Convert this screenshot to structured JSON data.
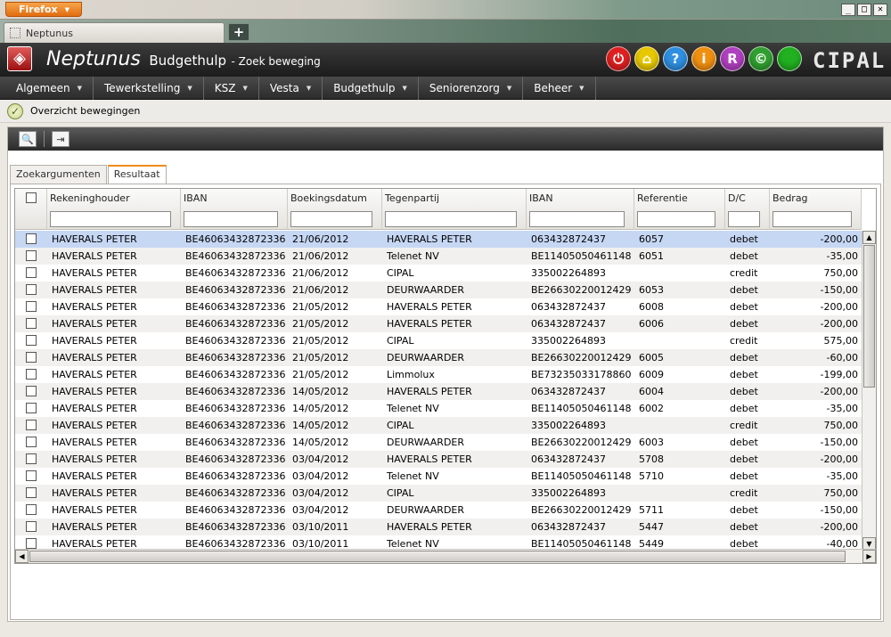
{
  "browser": {
    "menu_label": "Firefox",
    "tab_title": "Neptunus",
    "new_tab": "+",
    "win_min": "_",
    "win_max": "□",
    "win_close": "✕"
  },
  "app": {
    "name": "Neptunus",
    "module": "Budgethulp",
    "subtitle": "- Zoek beweging",
    "vendor_logo": "CIPAL",
    "header_icons": [
      {
        "name": "power-icon",
        "glyph": "⏻",
        "color": "#e02020"
      },
      {
        "name": "home-icon",
        "glyph": "⌂",
        "color": "#e8c800"
      },
      {
        "name": "help-icon",
        "glyph": "?",
        "color": "#2f8fe0"
      },
      {
        "name": "info-icon",
        "glyph": "i",
        "color": "#f09010"
      },
      {
        "name": "r-icon",
        "glyph": "R",
        "color": "#b040c0"
      },
      {
        "name": "copyright-icon",
        "glyph": "©",
        "color": "#30a030"
      },
      {
        "name": "status-icon",
        "glyph": "",
        "color": "#20b020"
      }
    ]
  },
  "menu": [
    "Algemeen",
    "Tewerkstelling",
    "KSZ",
    "Vesta",
    "Budgethulp",
    "Seniorenzorg",
    "Beheer"
  ],
  "status": {
    "text": "Overzicht bewegingen"
  },
  "toolbar": {
    "search_icon": "🔍",
    "exit_icon": "⇥"
  },
  "tabs": [
    {
      "label": "Zoekargumenten",
      "active": false
    },
    {
      "label": "Resultaat",
      "active": true
    }
  ],
  "grid": {
    "columns": [
      "Rekeninghouder",
      "IBAN",
      "Boekingsdatum",
      "Tegenpartij",
      "IBAN",
      "Referentie",
      "D/C",
      "Bedrag"
    ],
    "rows": [
      [
        "HAVERALS PETER",
        "BE46063432872336",
        "21/06/2012",
        "HAVERALS PETER",
        "063432872437",
        "6057",
        "debet",
        "-200,00"
      ],
      [
        "HAVERALS PETER",
        "BE46063432872336",
        "21/06/2012",
        "Telenet NV",
        "BE11405050461148",
        "6051",
        "debet",
        "-35,00"
      ],
      [
        "HAVERALS PETER",
        "BE46063432872336",
        "21/06/2012",
        "CIPAL",
        "335002264893",
        "",
        "credit",
        "750,00"
      ],
      [
        "HAVERALS PETER",
        "BE46063432872336",
        "21/06/2012",
        "DEURWAARDER",
        "BE26630220012429",
        "6053",
        "debet",
        "-150,00"
      ],
      [
        "HAVERALS PETER",
        "BE46063432872336",
        "21/05/2012",
        "HAVERALS PETER",
        "063432872437",
        "6008",
        "debet",
        "-200,00"
      ],
      [
        "HAVERALS PETER",
        "BE46063432872336",
        "21/05/2012",
        "HAVERALS PETER",
        "063432872437",
        "6006",
        "debet",
        "-200,00"
      ],
      [
        "HAVERALS PETER",
        "BE46063432872336",
        "21/05/2012",
        "CIPAL",
        "335002264893",
        "",
        "credit",
        "575,00"
      ],
      [
        "HAVERALS PETER",
        "BE46063432872336",
        "21/05/2012",
        "DEURWAARDER",
        "BE26630220012429",
        "6005",
        "debet",
        "-60,00"
      ],
      [
        "HAVERALS PETER",
        "BE46063432872336",
        "21/05/2012",
        "Limmolux",
        "BE73235033178860",
        "6009",
        "debet",
        "-199,00"
      ],
      [
        "HAVERALS PETER",
        "BE46063432872336",
        "14/05/2012",
        "HAVERALS PETER",
        "063432872437",
        "6004",
        "debet",
        "-200,00"
      ],
      [
        "HAVERALS PETER",
        "BE46063432872336",
        "14/05/2012",
        "Telenet NV",
        "BE11405050461148",
        "6002",
        "debet",
        "-35,00"
      ],
      [
        "HAVERALS PETER",
        "BE46063432872336",
        "14/05/2012",
        "CIPAL",
        "335002264893",
        "",
        "credit",
        "750,00"
      ],
      [
        "HAVERALS PETER",
        "BE46063432872336",
        "14/05/2012",
        "DEURWAARDER",
        "BE26630220012429",
        "6003",
        "debet",
        "-150,00"
      ],
      [
        "HAVERALS PETER",
        "BE46063432872336",
        "03/04/2012",
        "HAVERALS PETER",
        "063432872437",
        "5708",
        "debet",
        "-200,00"
      ],
      [
        "HAVERALS PETER",
        "BE46063432872336",
        "03/04/2012",
        "Telenet NV",
        "BE11405050461148",
        "5710",
        "debet",
        "-35,00"
      ],
      [
        "HAVERALS PETER",
        "BE46063432872336",
        "03/04/2012",
        "CIPAL",
        "335002264893",
        "",
        "credit",
        "750,00"
      ],
      [
        "HAVERALS PETER",
        "BE46063432872336",
        "03/04/2012",
        "DEURWAARDER",
        "BE26630220012429",
        "5711",
        "debet",
        "-150,00"
      ],
      [
        "HAVERALS PETER",
        "BE46063432872336",
        "03/10/2011",
        "HAVERALS PETER",
        "063432872437",
        "5447",
        "debet",
        "-200,00"
      ],
      [
        "HAVERALS PETER",
        "BE46063432872336",
        "03/10/2011",
        "Telenet NV",
        "BE11405050461148",
        "5449",
        "debet",
        "-40,00"
      ]
    ]
  }
}
